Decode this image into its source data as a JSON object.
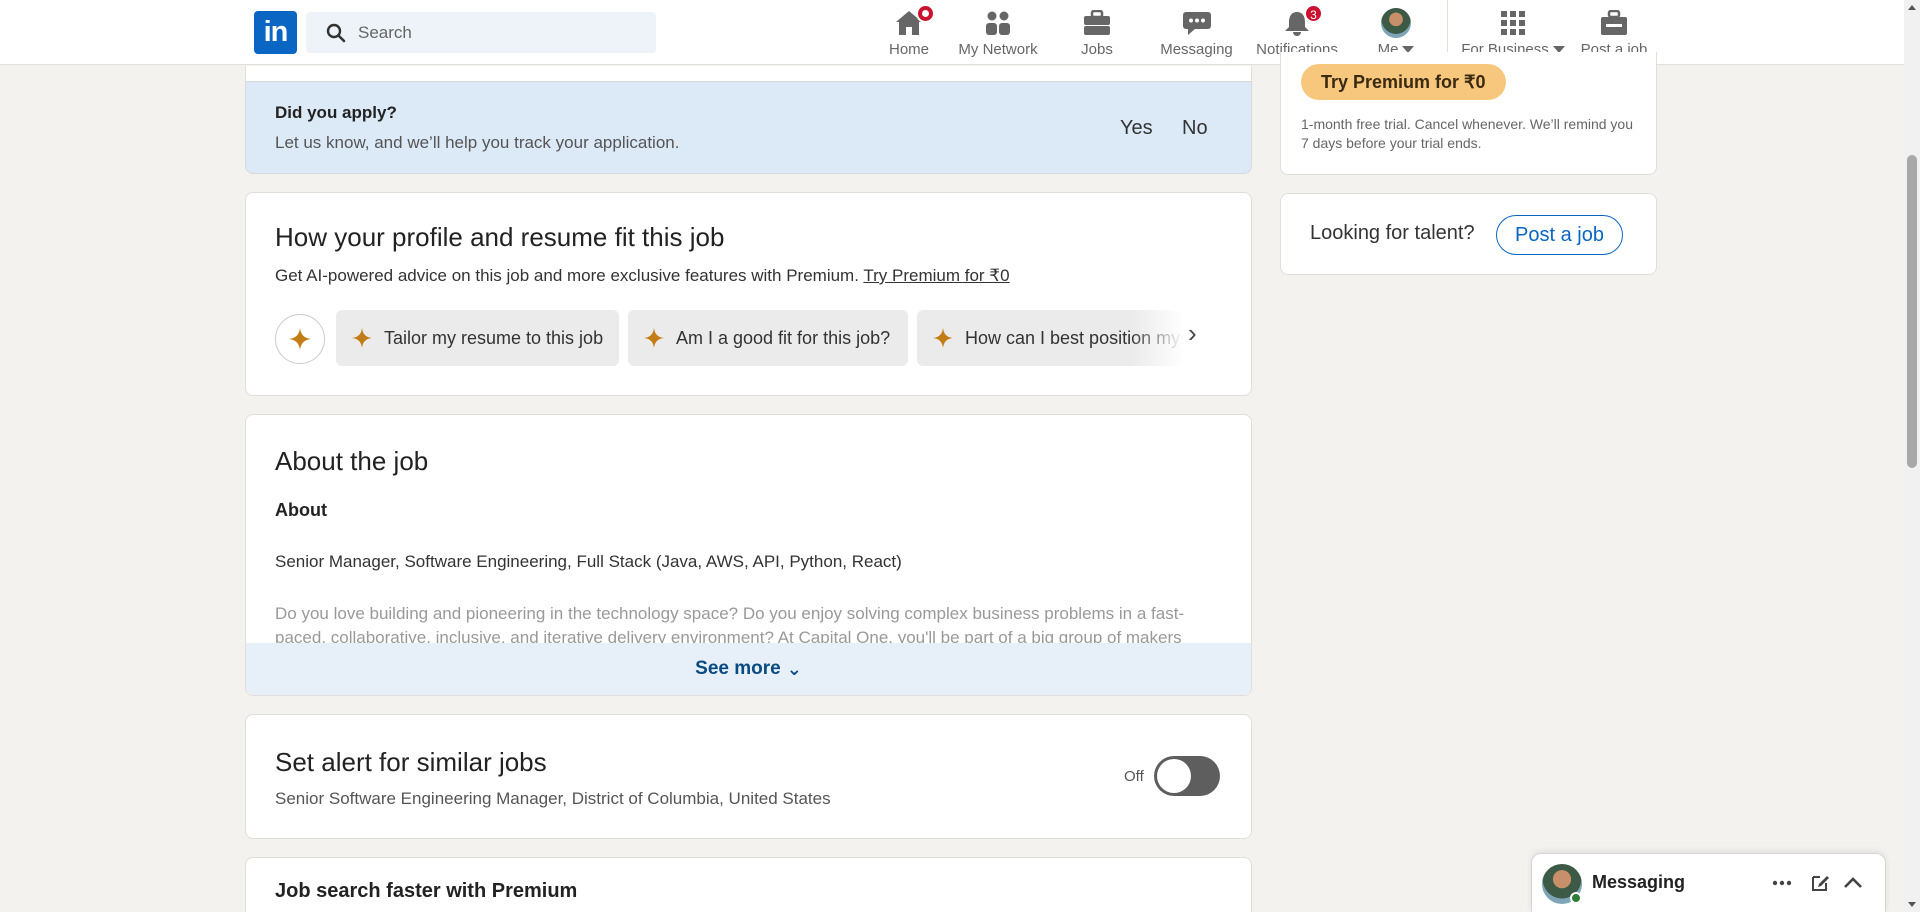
{
  "nav": {
    "logo_text": "in",
    "search_placeholder": "Search",
    "items": [
      {
        "label": "Home",
        "icon": "home-icon"
      },
      {
        "label": "My Network",
        "icon": "network-icon"
      },
      {
        "label": "Jobs",
        "icon": "briefcase-icon"
      },
      {
        "label": "Messaging",
        "icon": "messaging-icon"
      },
      {
        "label": "Notifications",
        "icon": "bell-icon",
        "badge": "3"
      },
      {
        "label": "Me",
        "icon": "avatar"
      },
      {
        "label": "For Business",
        "icon": "grid-icon"
      },
      {
        "label": "Post a job",
        "icon": "post-job-icon"
      }
    ]
  },
  "apply_prompt": {
    "question": "Did you apply?",
    "subtitle": "Let us know, and we’ll help you track your application.",
    "yes": "Yes",
    "no": "No"
  },
  "fit": {
    "title": "How your profile and resume fit this job",
    "desc": "Get AI-powered advice on this job and more exclusive features with Premium. ",
    "premium_link": "Try Premium for ₹0",
    "chips": [
      "Tailor my resume to this job",
      "Am I a good fit for this job?",
      "How can I best position myself for this job?"
    ]
  },
  "about": {
    "title": "About the job",
    "section": "About",
    "job_title": "Senior Manager, Software Engineering, Full Stack (Java, AWS, API, Python, React)",
    "body": "Do you love building and pioneering in the technology space? Do you enjoy solving complex business problems in a fast-paced, collaborative, inclusive, and iterative delivery environment? At Capital One, you'll be part of a big group of makers",
    "see_more": "See more"
  },
  "alert": {
    "title": "Set alert for similar jobs",
    "subtitle": "Senior Software Engineering Manager, District of Columbia, United States",
    "toggle_label": "Off"
  },
  "premium_section": {
    "title": "Job search faster with Premium"
  },
  "right_rail": {
    "try_button": "Try Premium for ₹0",
    "trial_note": "1-month free trial. Cancel whenever. We’ll remind you 7 days before your trial ends.",
    "talent_label": "Looking for talent?",
    "post_job": "Post a job"
  },
  "messaging": {
    "title": "Messaging"
  },
  "colors": {
    "brand": "#0a66c2",
    "badge": "#cb112d",
    "premium_gold": "#f8c77e",
    "spark": "#c37d16"
  }
}
